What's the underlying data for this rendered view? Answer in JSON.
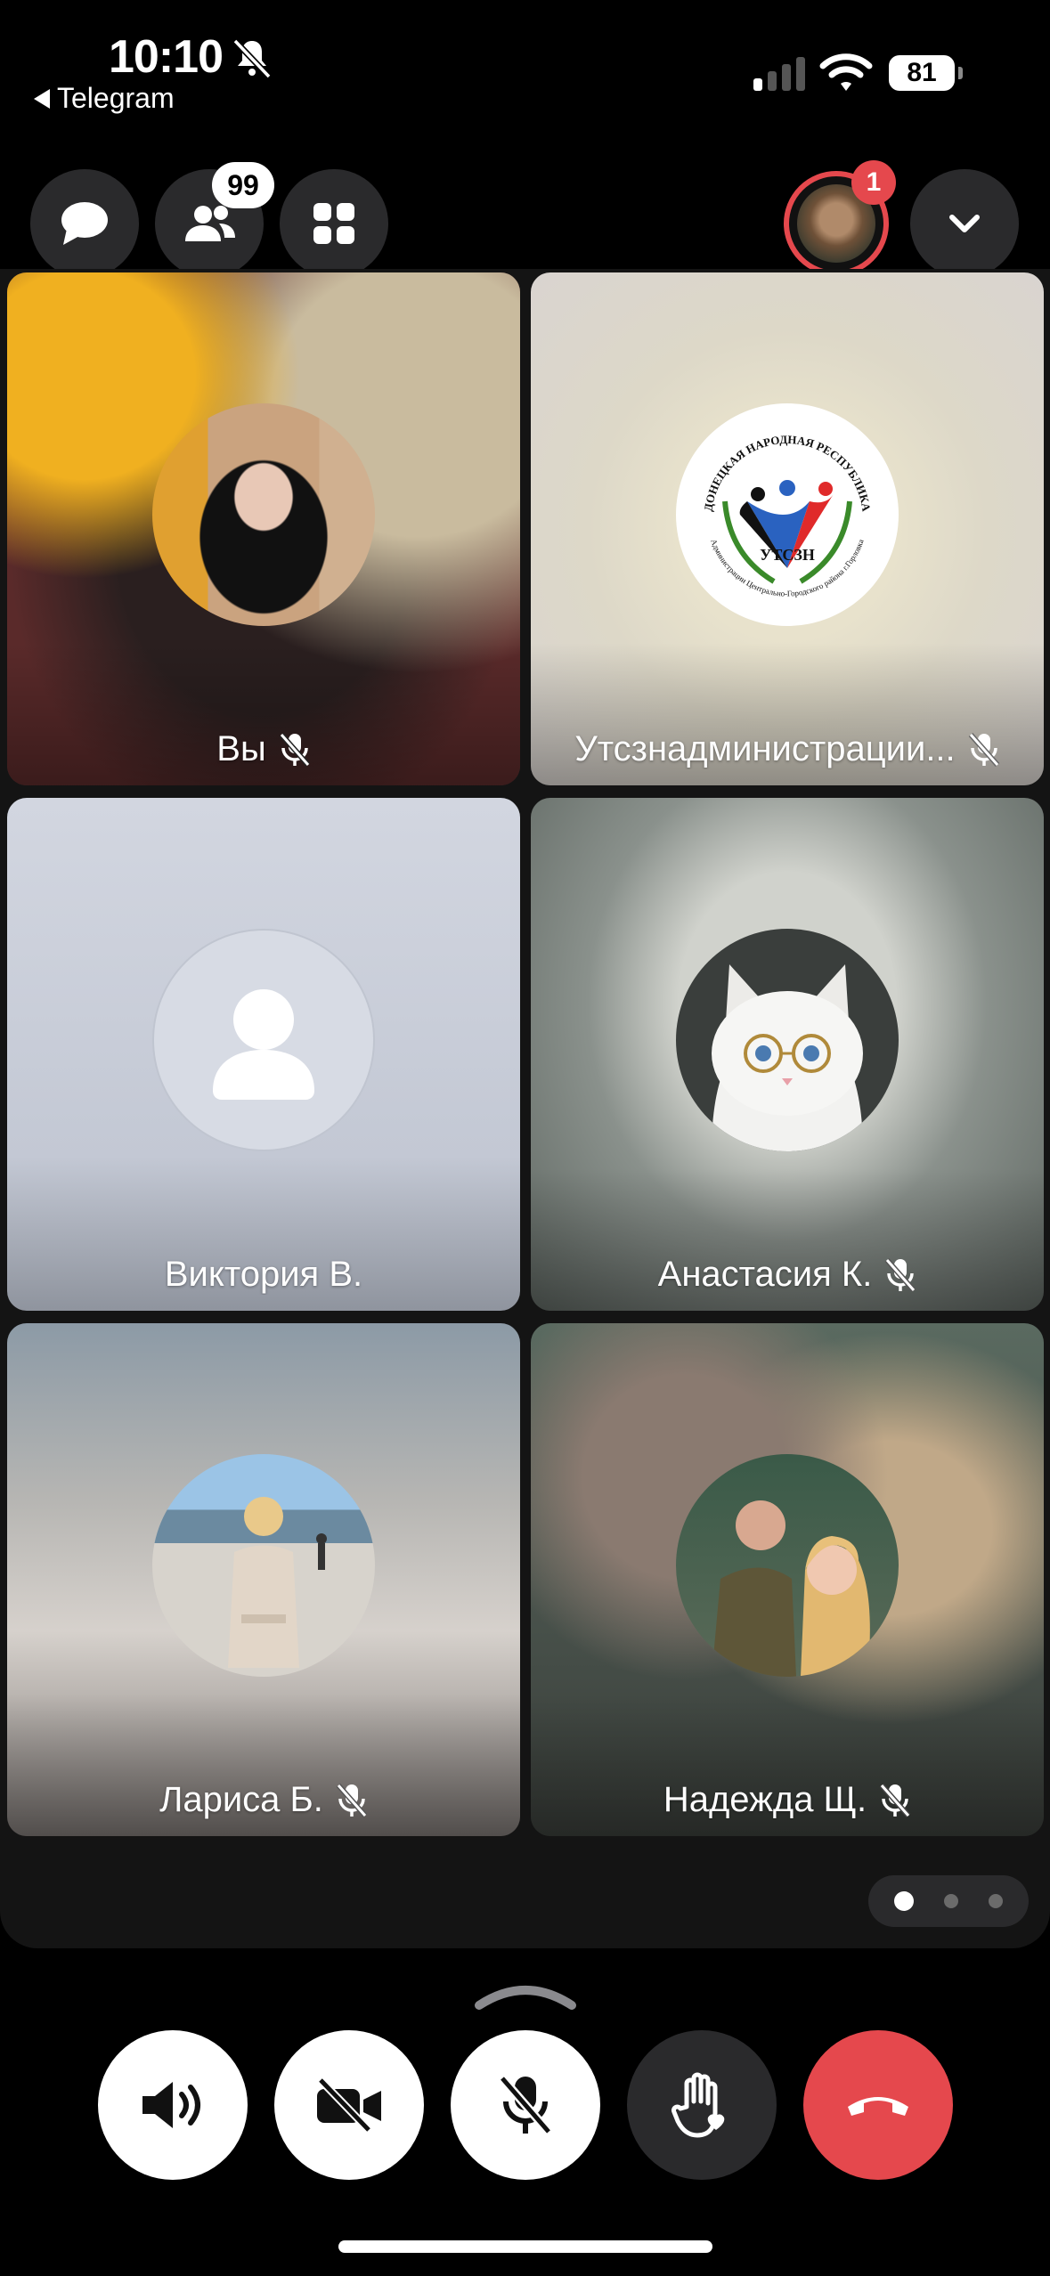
{
  "status": {
    "time": "10:10",
    "back_app": "Telegram",
    "battery": "81",
    "signal_bars_active": 1,
    "signal_bars_total": 4
  },
  "top": {
    "chat_icon": "chat-bubble-icon",
    "participants_icon": "people-icon",
    "participants_badge": "99",
    "layout_icon": "grid-icon",
    "speaker_badge": "1",
    "collapse_icon": "chevron-down-icon"
  },
  "tiles": [
    {
      "name": "Вы",
      "muted": true,
      "avatar": "photo-woman-dark-hair"
    },
    {
      "name": "Утсзнадминистрации...",
      "muted": true,
      "avatar": "dnr-logo",
      "logo": {
        "arc_text": "ДОНЕЦКАЯ НАРОДНАЯ РЕСПУБЛИКА",
        "center_text": "УТСЗН",
        "bottom_text": "Администрации Центрально-Городского района г.Горловка"
      }
    },
    {
      "name": "Виктория В.",
      "muted": false,
      "avatar": "placeholder-person"
    },
    {
      "name": "Анастасия К.",
      "muted": true,
      "avatar": "photo-white-cat-glasses"
    },
    {
      "name": "Лариса Б.",
      "muted": true,
      "avatar": "photo-woman-seaside"
    },
    {
      "name": "Надежда Щ.",
      "muted": true,
      "avatar": "photo-couple"
    }
  ],
  "pager": {
    "pages": 3,
    "current": 1
  },
  "controls": [
    {
      "name": "speaker-button",
      "icon": "speaker-icon"
    },
    {
      "name": "video-off-button",
      "icon": "video-off-icon"
    },
    {
      "name": "mute-button",
      "icon": "mic-off-icon"
    },
    {
      "name": "raise-hand-button",
      "icon": "raise-hand-icon"
    },
    {
      "name": "end-call-button",
      "icon": "phone-hangup-icon"
    }
  ],
  "colors": {
    "accent_red": "#e5484d",
    "button_dark": "#2a2a2c",
    "background": "#000000"
  }
}
